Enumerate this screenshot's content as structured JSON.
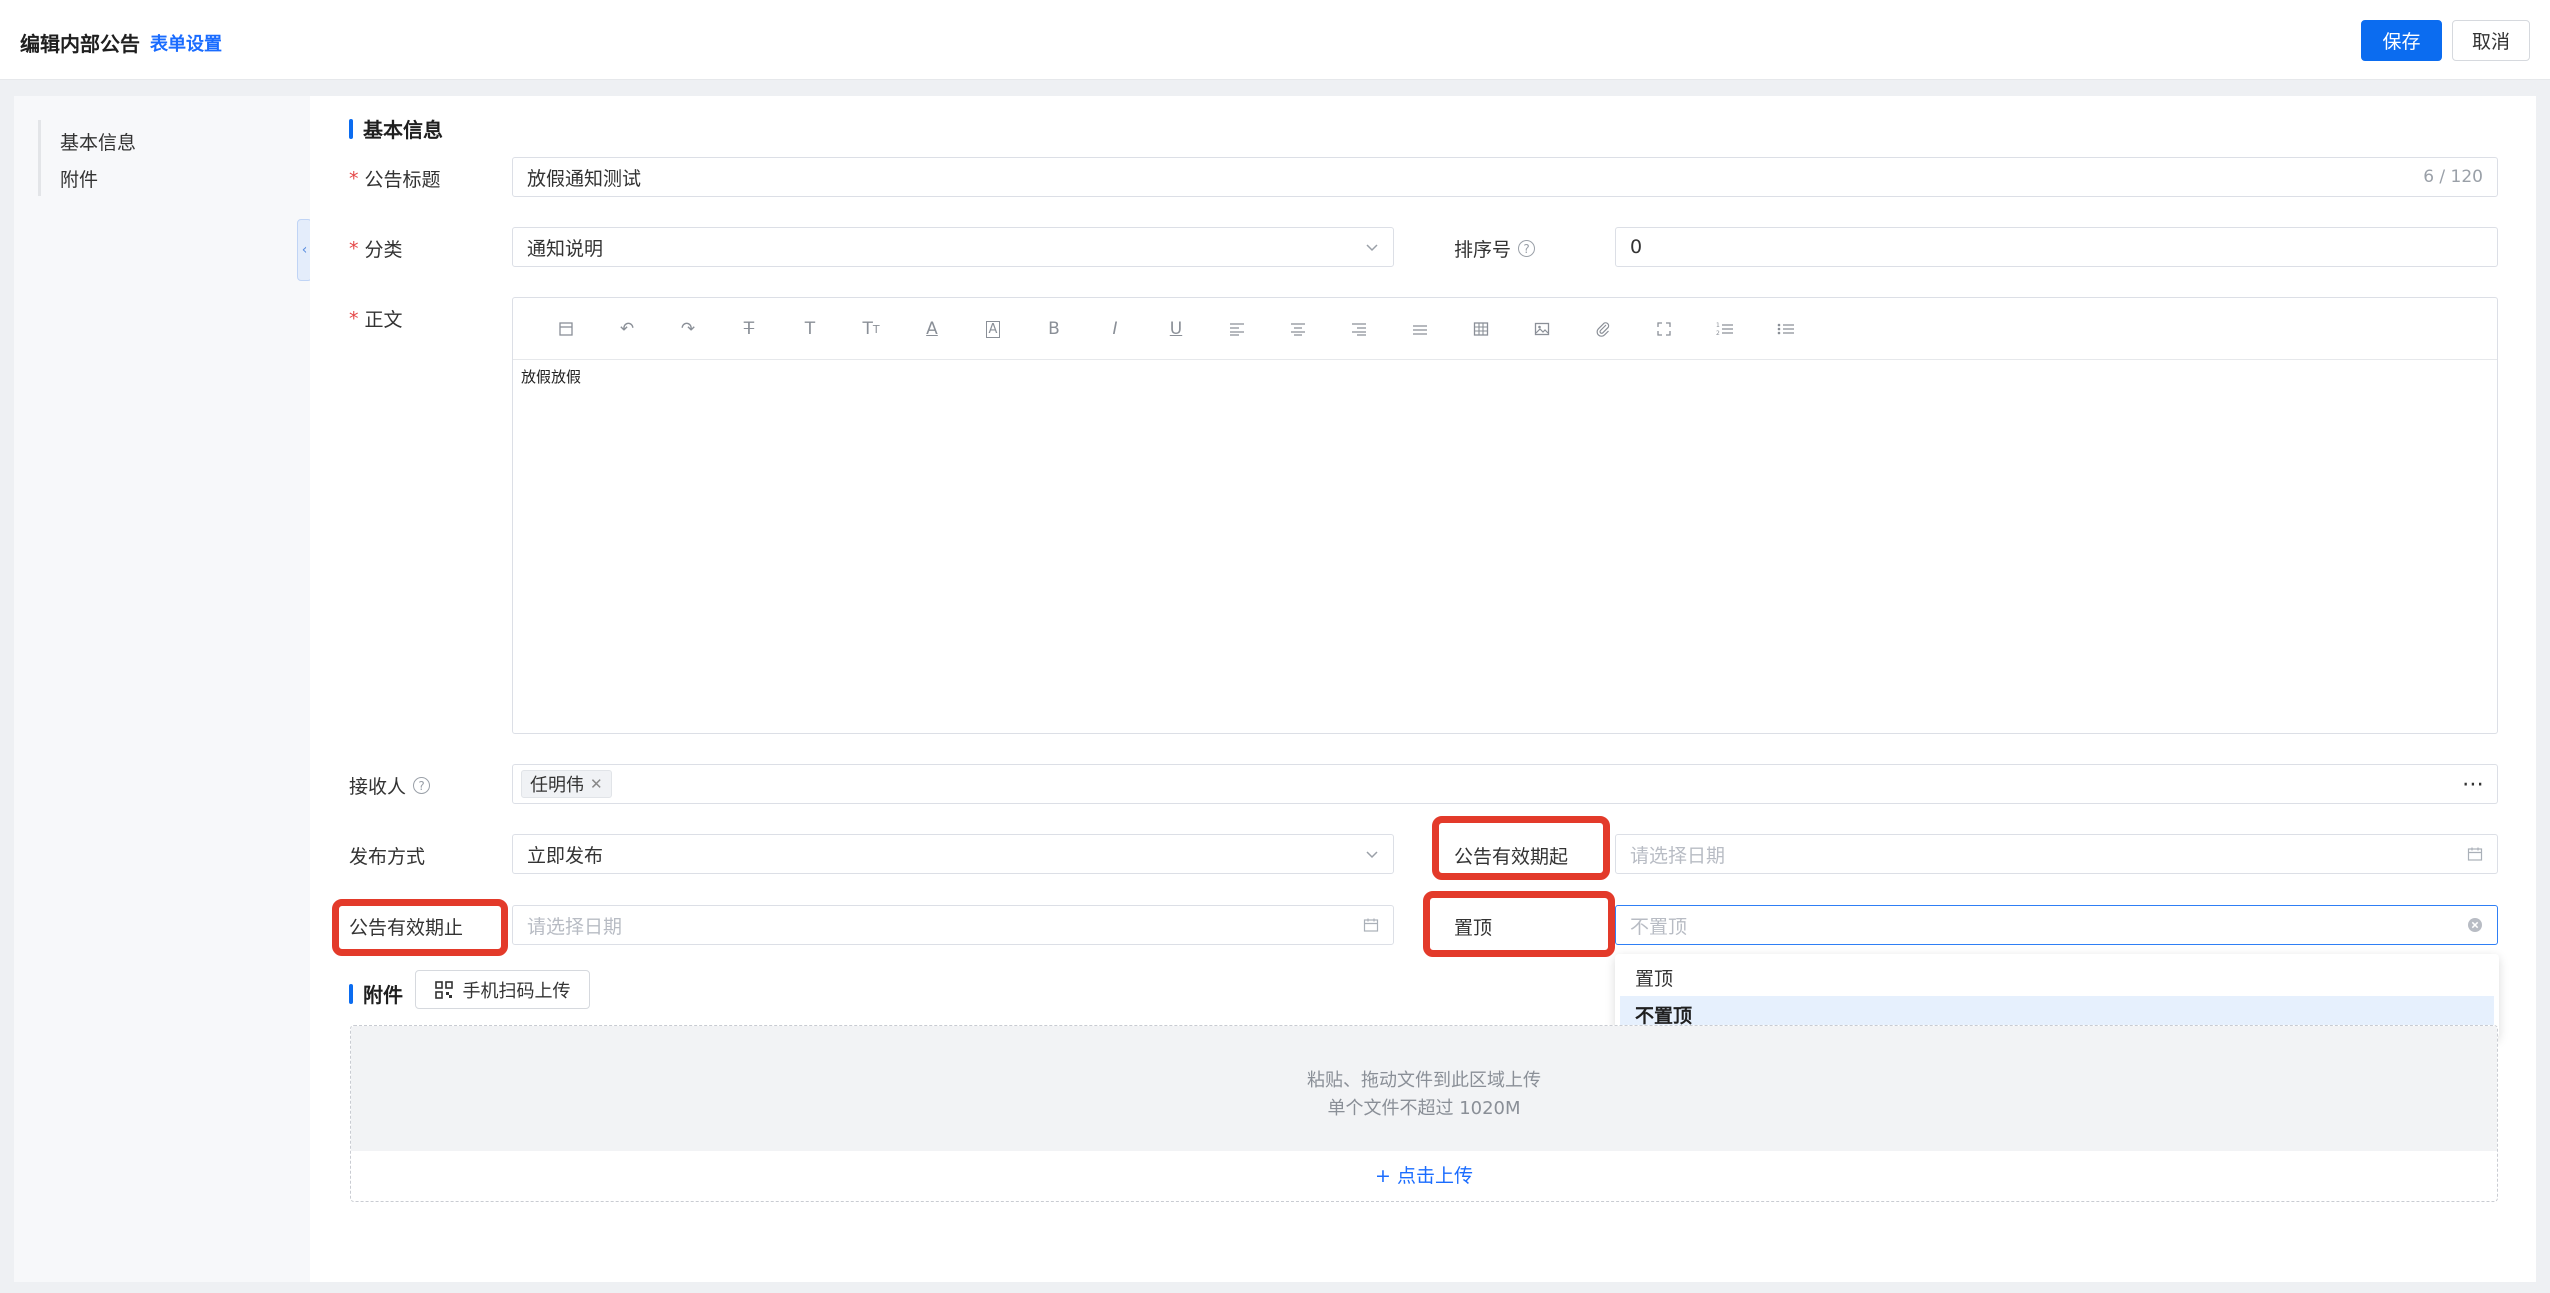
{
  "header": {
    "title": "编辑内部公告",
    "form_settings": "表单设置",
    "save_label": "保存",
    "cancel_label": "取消"
  },
  "nav": {
    "items": [
      {
        "label": "基本信息"
      },
      {
        "label": "附件"
      }
    ]
  },
  "basic": {
    "section_title": "基本信息",
    "title_label": "公告标题",
    "title_value": "放假通知测试",
    "title_count": "6 / 120",
    "category_label": "分类",
    "category_value": "通知说明",
    "sort_label": "排序号",
    "sort_value": "0",
    "body_label": "正文",
    "body_content": "放假放假",
    "recipient_label": "接收人",
    "recipient_tag": "任明伟",
    "publish_label": "发布方式",
    "publish_value": "立即发布",
    "valid_from_label": "公告有效期起",
    "valid_from_placeholder": "请选择日期",
    "valid_to_label": "公告有效期止",
    "valid_to_placeholder": "请选择日期",
    "pin_label": "置顶",
    "pin_placeholder": "不置顶"
  },
  "dropdown": {
    "options": [
      {
        "label": "置顶"
      },
      {
        "label": "不置顶"
      }
    ],
    "selected": "不置顶"
  },
  "attachments": {
    "section_title": "附件",
    "mobile_upload_label": "手机扫码上传",
    "drop_line1": "粘贴、拖动文件到此区域上传",
    "drop_line2": "单个文件不超过 1020M",
    "click_upload": "+ 点击上传"
  },
  "colors": {
    "primary": "#0b6cf0",
    "highlight": "#e33a2a",
    "required": "#e54848"
  }
}
